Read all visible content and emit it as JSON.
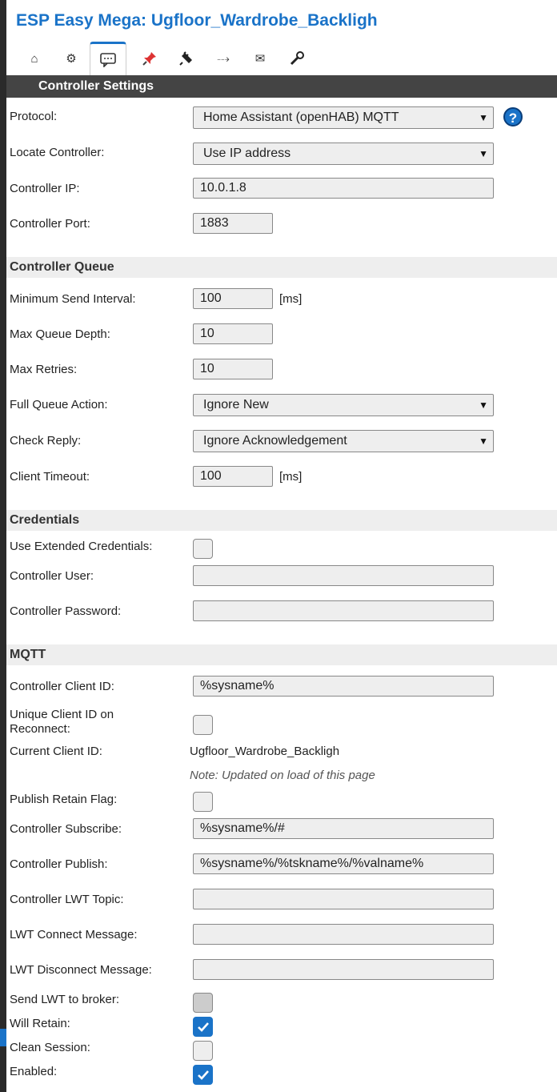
{
  "header": {
    "title": "ESP Easy Mega: Ugfloor_Wardrobe_Backligh"
  },
  "tabs": [
    {
      "name": "home",
      "glyph": "⌂"
    },
    {
      "name": "config",
      "glyph": "⚙"
    },
    {
      "name": "controllers",
      "glyph": "💬"
    },
    {
      "name": "hardware",
      "glyph": "📌"
    },
    {
      "name": "devices",
      "glyph": "🔌"
    },
    {
      "name": "rules",
      "glyph": "⤏"
    },
    {
      "name": "notifications",
      "glyph": "✉"
    },
    {
      "name": "tools",
      "glyph": "🔧"
    }
  ],
  "section_title": "Controller Settings",
  "protocol": {
    "label": "Protocol:",
    "value": "Home Assistant (openHAB) MQTT",
    "help": "?"
  },
  "locate": {
    "label": "Locate Controller:",
    "value": "Use IP address"
  },
  "ip": {
    "label": "Controller IP:",
    "value": "10.0.1.8"
  },
  "port": {
    "label": "Controller Port:",
    "value": "1883"
  },
  "queue": {
    "title": "Controller Queue",
    "min_send": {
      "label": "Minimum Send Interval:",
      "value": "100",
      "unit": "[ms]"
    },
    "max_depth": {
      "label": "Max Queue Depth:",
      "value": "10"
    },
    "max_retries": {
      "label": "Max Retries:",
      "value": "10"
    },
    "full_action": {
      "label": "Full Queue Action:",
      "value": "Ignore New"
    },
    "check_reply": {
      "label": "Check Reply:",
      "value": "Ignore Acknowledgement"
    },
    "timeout": {
      "label": "Client Timeout:",
      "value": "100",
      "unit": "[ms]"
    }
  },
  "credentials": {
    "title": "Credentials",
    "extended": {
      "label": "Use Extended Credentials:",
      "checked": false
    },
    "user": {
      "label": "Controller User:",
      "value": ""
    },
    "password": {
      "label": "Controller Password:",
      "value": ""
    }
  },
  "mqtt": {
    "title": "MQTT",
    "client_id": {
      "label": "Controller Client ID:",
      "value": "%sysname%"
    },
    "unique_id": {
      "label_1": "Unique Client ID on",
      "label_2": "Reconnect:",
      "checked": false
    },
    "current_id": {
      "label": "Current Client ID:",
      "value": "Ugfloor_Wardrobe_Backligh",
      "note": "Note: Updated on load of this page"
    },
    "retain": {
      "label": "Publish Retain Flag:",
      "checked": false
    },
    "subscribe": {
      "label": "Controller Subscribe:",
      "value": "%sysname%/#"
    },
    "publish": {
      "label": "Controller Publish:",
      "value": "%sysname%/%tskname%/%valname%"
    },
    "lwt_topic": {
      "label": "Controller LWT Topic:",
      "value": ""
    },
    "lwt_connect": {
      "label": "LWT Connect Message:",
      "value": ""
    },
    "lwt_disconnect": {
      "label": "LWT Disconnect Message:",
      "value": ""
    },
    "send_lwt": {
      "label": "Send LWT to broker:",
      "checked": false
    },
    "will_retain": {
      "label": "Will Retain:",
      "checked": true
    },
    "clean_session": {
      "label": "Clean Session:",
      "checked": false
    },
    "enabled": {
      "label": "Enabled:",
      "checked": true
    }
  },
  "colors": {
    "accent": "#1a73c8",
    "section_bar": "#444444",
    "subhead": "#eeeeee"
  }
}
